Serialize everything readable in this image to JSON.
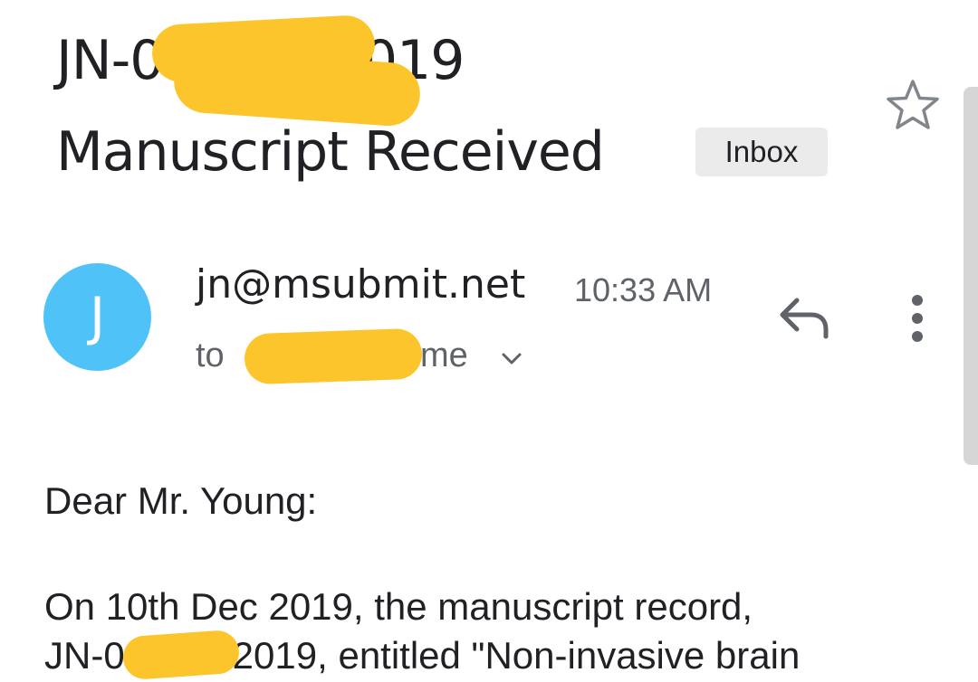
{
  "email": {
    "subject_line1": "JN-0         -2019",
    "subject_line2": "Manuscript Received",
    "label": "Inbox",
    "sender": {
      "avatar_initial": "J",
      "avatar_color": "#4fc3f7",
      "address": "jn@msubmit.net",
      "time": "10:33 AM"
    },
    "recipient": {
      "to_label": "to",
      "me_label": "me"
    },
    "body": {
      "greeting": "Dear Mr. Young:",
      "line1": "On 10th Dec 2019, the manuscript record,",
      "line2": "JN-0         -2019, entitled \"Non-invasive brain"
    }
  },
  "icons": {
    "star": "star-outline-icon",
    "reply": "reply-icon",
    "more": "more-vert-icon",
    "expand": "chevron-down-icon"
  },
  "colors": {
    "redaction": "#fbc52b",
    "label_bg": "#ebebeb",
    "secondary_text": "#5f6368",
    "primary_text": "#202124"
  }
}
